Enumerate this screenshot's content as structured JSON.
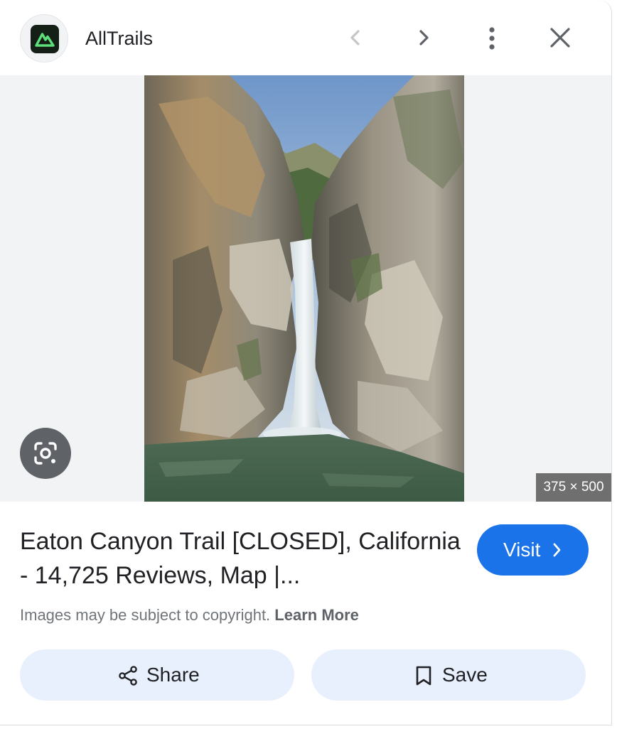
{
  "header": {
    "site_name": "AllTrails",
    "logo_icon": "alltrails-logo-icon",
    "back_icon": "chevron-left-icon",
    "forward_icon": "chevron-right-icon",
    "more_icon": "more-vertical-icon",
    "close_icon": "close-icon"
  },
  "image": {
    "dimensions": "375 × 500",
    "lens_icon": "google-lens-icon"
  },
  "result": {
    "title": "Eaton Canyon Trail [CLOSED], California - 14,725 Reviews, Map |...",
    "visit_label": "Visit",
    "copyright_text": "Images may be subject to copyright.",
    "learn_more": "Learn More"
  },
  "actions": {
    "share_label": "Share",
    "save_label": "Save"
  },
  "colors": {
    "accent": "#1a73e8",
    "action_bg": "#e8f0fe",
    "logo_green": "#5ee07a"
  }
}
